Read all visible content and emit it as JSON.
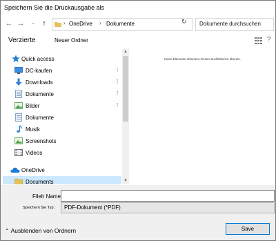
{
  "window": {
    "title": "Speichern Sie die Druckausgabe als"
  },
  "address_bar": {
    "back_icon": "arrow-left-icon",
    "forward_icon": "arrow-right-icon",
    "recent_icon": "chevron-down-icon",
    "up_icon": "arrow-up-icon",
    "breadcrumbs": [
      "OneDrive",
      "Dokumente"
    ],
    "separator": "›",
    "refresh_icon": "refresh-icon",
    "search_placeholder": "Dokumente durchsuchen"
  },
  "toolbar": {
    "organize_label": "Verzierte",
    "new_folder_label": "Neuer Ordner"
  },
  "nav_pane": {
    "items": [
      {
        "label": "Quick access",
        "icon": "star-icon",
        "level": 0,
        "pinned": false
      },
      {
        "label": "DC-kaufen",
        "icon": "monitor-icon",
        "level": 1,
        "pinned": true
      },
      {
        "label": "Downloads",
        "icon": "download-icon",
        "level": 1,
        "pinned": true
      },
      {
        "label": "Dokumente",
        "icon": "documents-icon",
        "level": 1,
        "pinned": true
      },
      {
        "label": "Bilder",
        "icon": "pictures-icon",
        "level": 1,
        "pinned": true
      },
      {
        "label": "Dokumente",
        "icon": "documents-icon",
        "level": 1,
        "pinned": false
      },
      {
        "label": "Musik",
        "icon": "music-icon",
        "level": 1,
        "pinned": false
      },
      {
        "label": "Screenshots",
        "icon": "pictures-icon",
        "level": 1,
        "pinned": false
      },
      {
        "label": "Videos",
        "icon": "video-icon",
        "level": 1,
        "pinned": false
      },
      {
        "label": "OneDrive",
        "icon": "cloud-icon",
        "level": 0,
        "pinned": false
      },
      {
        "label": "Documents",
        "icon": "documents-icon",
        "level": 1,
        "pinned": false,
        "selected": true
      }
    ]
  },
  "content": {
    "empty_message": "Keine Elemente stimmen mit den Suchkriterien überein."
  },
  "bottom": {
    "filename_label": "Fileh Namen an:",
    "filename_value": "",
    "filetype_label": "Speichern Sie Typ:",
    "filetype_value": "PDF-Dokument (*PDF)",
    "hide_folders_label": "Ausblenden von Ordnern",
    "save_label": "Save"
  },
  "colors": {
    "selection": "#cce8ff",
    "accent": "#0078d7",
    "star": "#1e7ad8"
  }
}
